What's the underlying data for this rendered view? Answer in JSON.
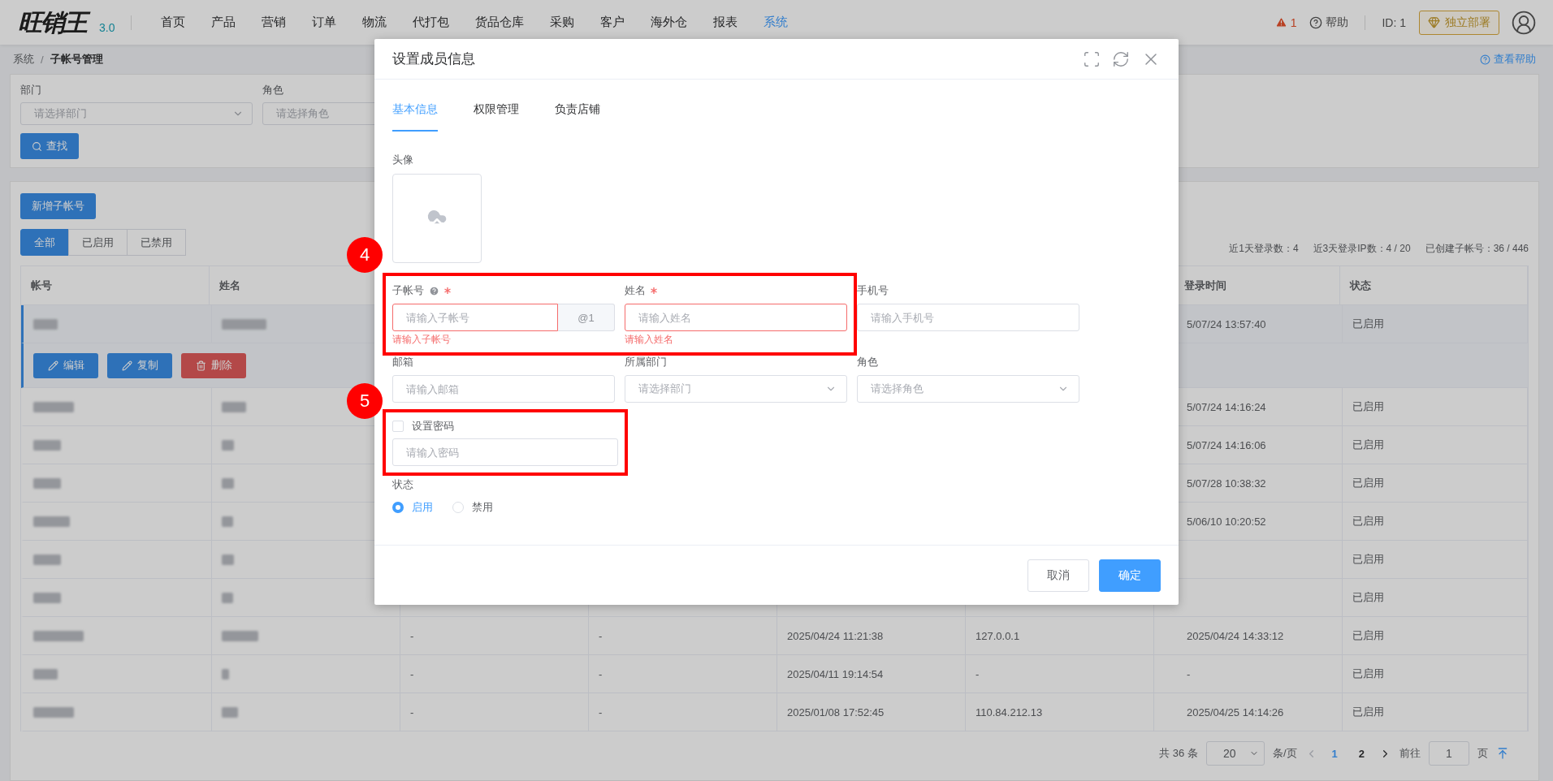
{
  "header": {
    "logo": "旺销王",
    "version": "3.0",
    "nav": [
      {
        "label": "首页",
        "selected": false
      },
      {
        "label": "产品",
        "selected": false
      },
      {
        "label": "营销",
        "selected": false
      },
      {
        "label": "订单",
        "selected": false
      },
      {
        "label": "物流",
        "selected": false
      },
      {
        "label": "代打包",
        "selected": false
      },
      {
        "label": "货品仓库",
        "selected": false
      },
      {
        "label": "采购",
        "selected": false
      },
      {
        "label": "客户",
        "selected": false
      },
      {
        "label": "海外仓",
        "selected": false
      },
      {
        "label": "报表",
        "selected": false
      },
      {
        "label": "系统",
        "selected": true
      }
    ],
    "alert_count": "1",
    "help": "帮助",
    "account_id": "ID: 1",
    "deploy_button": "独立部署"
  },
  "breadcrumb": [
    "系统",
    "子帐号管理"
  ],
  "breadcrumb_separator": "/",
  "help_link": "查看帮助",
  "filters": [
    {
      "label": "部门",
      "placeholder": "请选择部门"
    },
    {
      "label": "角色",
      "placeholder": "请选择角色"
    }
  ],
  "search_button": "查找",
  "add_button": "新增子帐号",
  "status_tabs": [
    {
      "label": "全部",
      "selected": true
    },
    {
      "label": "已启用",
      "selected": false
    },
    {
      "label": "已禁用",
      "selected": false
    }
  ],
  "stats": [
    "近1天登录数：4",
    "近3天登录IP数：4 / 20",
    "已创建子帐号：36 / 446"
  ],
  "table": {
    "columns": [
      "帐号",
      "姓名",
      null,
      null,
      null,
      null,
      "登录时间",
      "状态"
    ],
    "rows": [
      {
        "selected": true,
        "blurred": true,
        "cells": [
          null,
          null,
          null,
          null,
          null,
          null,
          "5/07/24 13:57:40",
          "已启用"
        ],
        "actions": [
          {
            "kind": "edit",
            "label": "编辑"
          },
          {
            "kind": "copy",
            "label": "复制"
          },
          {
            "kind": "delete",
            "label": "删除"
          }
        ]
      },
      {
        "selected": false,
        "blurred": true,
        "cells": [
          null,
          null,
          null,
          null,
          null,
          null,
          "5/07/24 14:16:24",
          "已启用"
        ]
      },
      {
        "selected": false,
        "blurred": true,
        "cells": [
          null,
          null,
          null,
          null,
          null,
          null,
          "5/07/24 14:16:06",
          "已启用"
        ]
      },
      {
        "selected": false,
        "blurred": true,
        "cells": [
          null,
          null,
          null,
          null,
          null,
          null,
          "5/07/28 10:38:32",
          "已启用"
        ]
      },
      {
        "selected": false,
        "blurred": true,
        "cells": [
          null,
          null,
          null,
          null,
          null,
          null,
          "5/06/10 10:20:52",
          "已启用"
        ]
      },
      {
        "selected": false,
        "blurred": true,
        "cells": [
          null,
          null,
          null,
          null,
          null,
          null,
          null,
          "已启用"
        ]
      },
      {
        "selected": false,
        "blurred": true,
        "cells": [
          null,
          null,
          null,
          null,
          null,
          null,
          null,
          "已启用"
        ]
      },
      {
        "selected": false,
        "blurred": true,
        "cells": [
          null,
          null,
          "-",
          "-",
          "2025/04/24 11:21:38",
          "127.0.0.1",
          "2025/04/24 14:33:12",
          "已启用"
        ]
      },
      {
        "selected": false,
        "blurred": true,
        "cells": [
          null,
          null,
          "-",
          "-",
          "2025/04/11 19:14:54",
          "-",
          "-",
          "已启用"
        ]
      },
      {
        "selected": false,
        "blurred": true,
        "cells": [
          null,
          null,
          "-",
          "-",
          "2025/01/08 17:52:45",
          "110.84.212.13",
          "2025/04/25 14:14:26",
          "已启用"
        ]
      }
    ]
  },
  "pagination": {
    "total": "共 36 条",
    "page_size": "20",
    "page_size_unit": "条/页",
    "pages": [
      {
        "label": "1",
        "selected": true
      },
      {
        "label": "2",
        "selected": false
      }
    ],
    "goto_label": "前往",
    "goto_value": "1",
    "goto_unit": "页"
  },
  "dialog": {
    "title": "设置成员信息",
    "tabs": [
      {
        "label": "基本信息",
        "selected": true
      },
      {
        "label": "权限管理",
        "selected": false
      },
      {
        "label": "负责店铺",
        "selected": false
      }
    ],
    "avatar_label": "头像",
    "field_rows": [
      {
        "annotation": "4",
        "fields": [
          {
            "kind": "text",
            "label": "子帐号",
            "help": true,
            "required": true,
            "placeholder": "请输入子帐号",
            "addon": "@1",
            "error": "请输入子帐号"
          },
          {
            "kind": "text",
            "label": "姓名",
            "help": false,
            "required": true,
            "placeholder": "请输入姓名",
            "error": "请输入姓名"
          },
          {
            "kind": "text",
            "label": "手机号",
            "help": false,
            "required": false,
            "placeholder": "请输入手机号"
          }
        ]
      },
      {
        "fields": [
          {
            "kind": "text",
            "label": "邮箱",
            "help": false,
            "required": false,
            "placeholder": "请输入邮箱"
          },
          {
            "kind": "select",
            "label": "所属部门",
            "help": false,
            "required": false,
            "placeholder": "请选择部门"
          },
          {
            "kind": "select",
            "label": "角色",
            "help": false,
            "required": false,
            "placeholder": "请选择角色"
          }
        ]
      }
    ],
    "password": {
      "label": "设置密码",
      "checked": false,
      "placeholder": "请输入密码",
      "annotation": "5"
    },
    "status": {
      "label": "状态",
      "options": [
        {
          "label": "启用",
          "selected": true
        },
        {
          "label": "禁用",
          "selected": false
        }
      ]
    },
    "buttons": [
      {
        "kind": "default",
        "label": "取消"
      },
      {
        "kind": "primary",
        "label": "确定"
      }
    ]
  }
}
